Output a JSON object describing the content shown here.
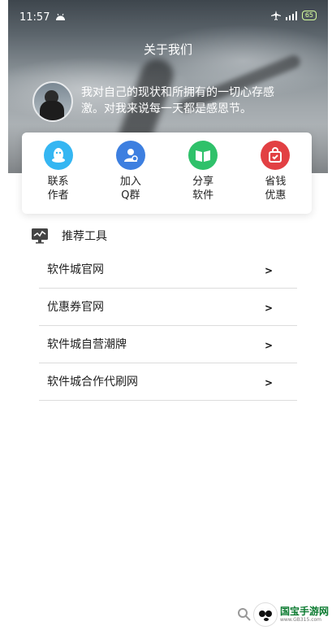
{
  "status_bar": {
    "time": "11:57",
    "battery": "65"
  },
  "header": {
    "title": "关于我们"
  },
  "profile": {
    "motto_line1": "我对自己的现状和所拥有的一切心存感",
    "motto_line2": "激。对我来说每一天都是感恩节。"
  },
  "actions": [
    {
      "line1": "联系",
      "line2": "作者",
      "icon": "qq-penguin-icon",
      "color": "#35b6f2"
    },
    {
      "line1": "加入",
      "line2": "Q群",
      "icon": "group-user-icon",
      "color": "#3d7fe0"
    },
    {
      "line1": "分享",
      "line2": "软件",
      "icon": "book-share-icon",
      "color": "#2fc16a"
    },
    {
      "line1": "省钱",
      "line2": "优惠",
      "icon": "shopping-bag-icon",
      "color": "#e24043"
    }
  ],
  "tools": {
    "title": "推荐工具",
    "items": [
      {
        "label": "软件城官网",
        "arrow": ">"
      },
      {
        "label": "优惠券官网",
        "arrow": ">"
      },
      {
        "label": "软件城自营潮牌",
        "arrow": ">"
      },
      {
        "label": "软件城合作代刷网",
        "arrow": ">"
      }
    ]
  },
  "watermark": {
    "main": "国宝手游网",
    "sub": "www.GB315.com"
  }
}
